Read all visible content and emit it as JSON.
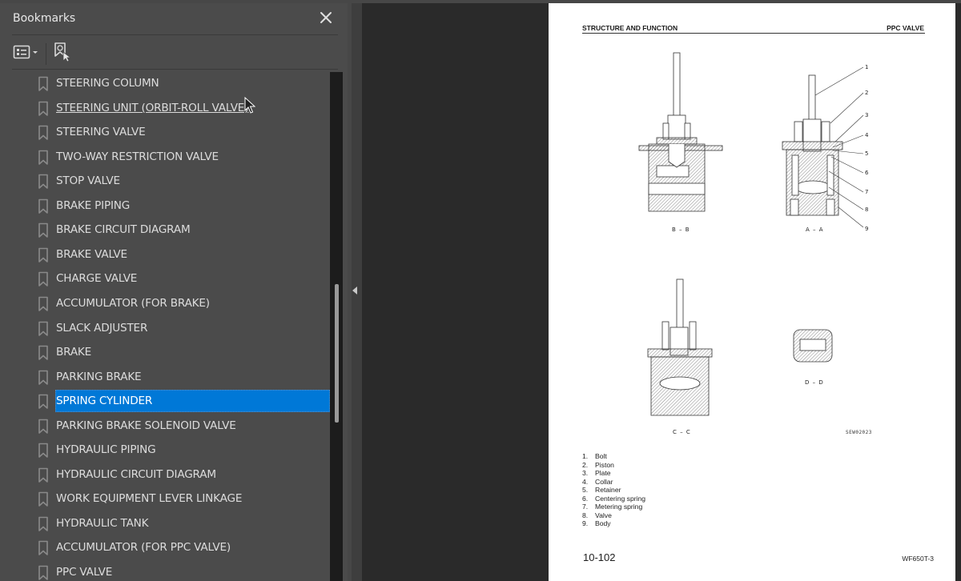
{
  "sidebar": {
    "title": "Bookmarks",
    "icons": {
      "close": "close-icon",
      "options": "options-list-icon",
      "options_dropdown": "chevron-down-icon",
      "find_bookmark": "find-current-bookmark-icon",
      "bookmark": "bookmark-icon",
      "collapse": "collapse-panel-arrow-icon"
    },
    "items": [
      {
        "label": "STEERING COLUMN"
      },
      {
        "label": "STEERING UNIT (ORBIT-ROLL VALVE)",
        "state": "hover"
      },
      {
        "label": "STEERING VALVE"
      },
      {
        "label": "TWO-WAY RESTRICTION VALVE"
      },
      {
        "label": "STOP VALVE"
      },
      {
        "label": "BRAKE PIPING"
      },
      {
        "label": "BRAKE CIRCUIT DIAGRAM"
      },
      {
        "label": "BRAKE VALVE"
      },
      {
        "label": "CHARGE VALVE"
      },
      {
        "label": "ACCUMULATOR (FOR BRAKE)"
      },
      {
        "label": "SLACK ADJUSTER"
      },
      {
        "label": "BRAKE"
      },
      {
        "label": "PARKING BRAKE"
      },
      {
        "label": "SPRING CYLINDER",
        "state": "selected"
      },
      {
        "label": "PARKING BRAKE SOLENOID VALVE"
      },
      {
        "label": "HYDRAULIC PIPING"
      },
      {
        "label": "HYDRAULIC CIRCUIT DIAGRAM"
      },
      {
        "label": "WORK EQUIPMENT LEVER LINKAGE"
      },
      {
        "label": "HYDRAULIC TANK"
      },
      {
        "label": "ACCUMULATOR (FOR PPC VALVE)"
      },
      {
        "label": "PPC VALVE"
      }
    ],
    "selected_color": "#0078d7"
  },
  "page": {
    "header_left": "STRUCTURE AND FUNCTION",
    "header_right": "PPC VALVE",
    "figure": {
      "views": [
        "B – B",
        "A – A",
        "C – C",
        "D – D"
      ],
      "callouts": [
        "1",
        "2",
        "3",
        "4",
        "5",
        "6",
        "7",
        "8",
        "9"
      ],
      "code": "SEW02023"
    },
    "legend": [
      {
        "num": "1.",
        "text": "Bolt"
      },
      {
        "num": "2.",
        "text": "Piston"
      },
      {
        "num": "3.",
        "text": "Plate"
      },
      {
        "num": "4.",
        "text": "Collar"
      },
      {
        "num": "5.",
        "text": "Retainer"
      },
      {
        "num": "6.",
        "text": "Centering spring"
      },
      {
        "num": "7.",
        "text": "Metering spring"
      },
      {
        "num": "8.",
        "text": "Valve"
      },
      {
        "num": "9.",
        "text": "Body"
      }
    ],
    "page_number": "10-102",
    "model": "WF650T-3"
  }
}
